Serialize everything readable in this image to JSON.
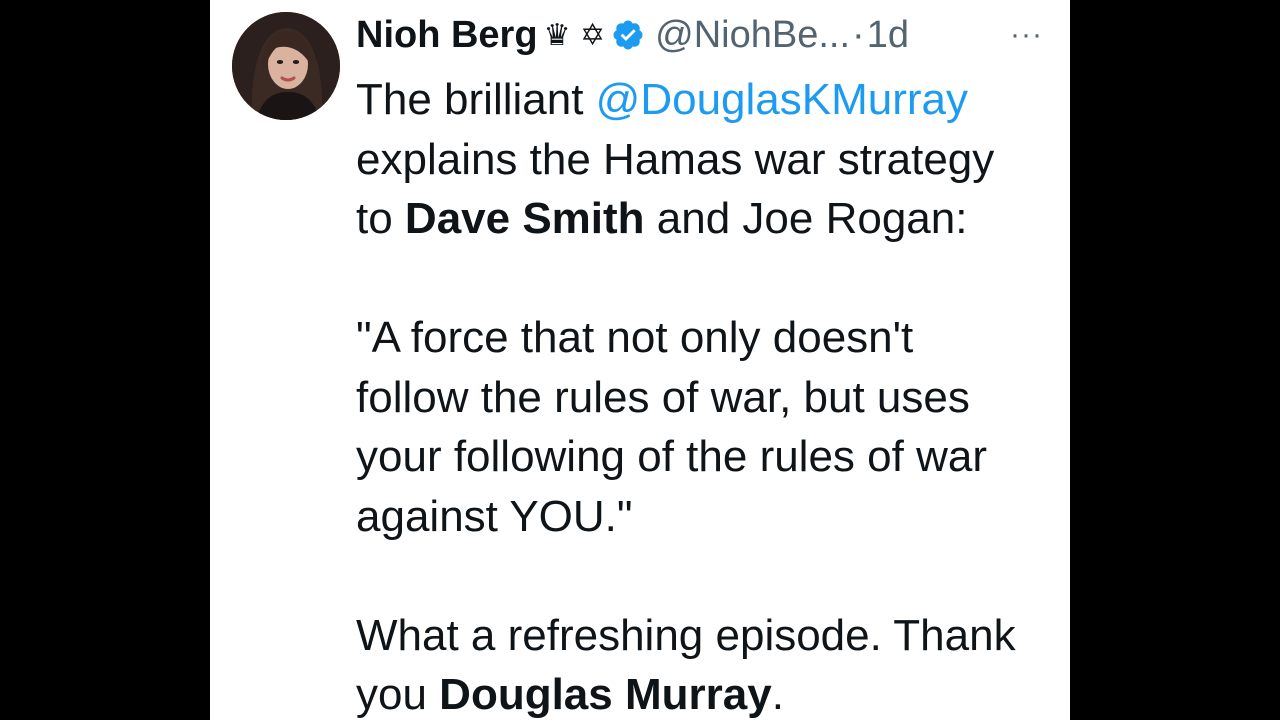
{
  "author": {
    "name": "Nioh Berg",
    "name_symbols": "♛ ✡",
    "handle": "@NiohBe...",
    "time_separator": "·",
    "timestamp": "1d",
    "verified_icon": "verified-badge-icon",
    "more_icon": "more-horizontal-icon",
    "more_label": "···"
  },
  "tweet": {
    "l1a": "The brilliant ",
    "l1b": "@DouglasKMurray",
    "l2": "explains the Hamas war strategy",
    "l3a": "to ",
    "l3b": "Dave Smith",
    "l3c": " and Joe Rogan:",
    "q1": "\"A force that not only doesn't",
    "q2": "follow the rules of war, but uses",
    "q3": "your following of the rules of war",
    "q4": "against YOU.\"",
    "e1": "What a refreshing episode. Thank",
    "e2a": "you ",
    "e2b": "Douglas Murray",
    "e2c": "."
  },
  "colors": {
    "background": "#000000",
    "card": "#ffffff",
    "text": "#0f1419",
    "secondary": "#536471",
    "link": "#1d9bf0",
    "verified": "#1d9bf0"
  }
}
